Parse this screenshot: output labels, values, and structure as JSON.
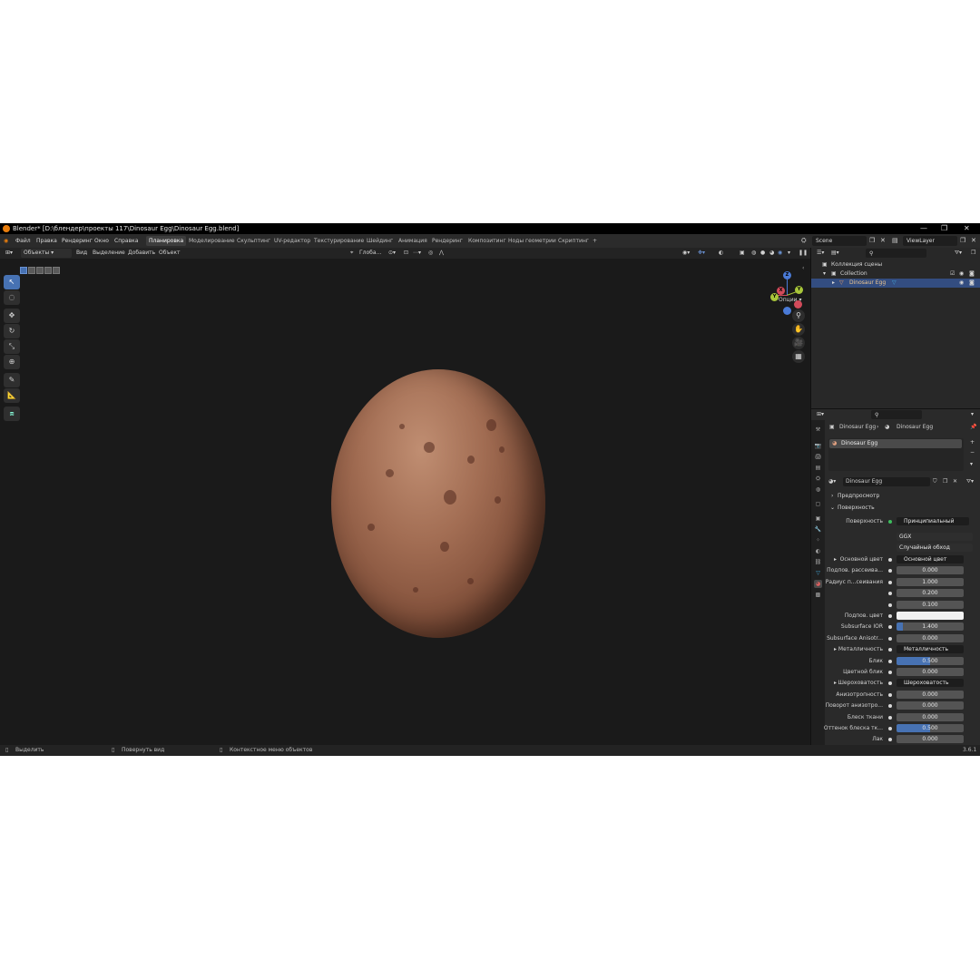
{
  "title_bar": {
    "title": "Blender* [D:\\блендер\\проекты 117\\Dinosaur Egg\\Dinosaur Egg.blend]",
    "minimize": "—",
    "maximize": "❐",
    "close": "✕"
  },
  "menu": [
    "Файл",
    "Правка",
    "Рендеринг",
    "Окно",
    "Справка"
  ],
  "workspaces": [
    {
      "label": "Планировка",
      "active": true
    },
    {
      "label": "Моделирование"
    },
    {
      "label": "Скульптинг"
    },
    {
      "label": "UV-редактор"
    },
    {
      "label": "Текстурирование"
    },
    {
      "label": "Шейдинг"
    },
    {
      "label": "Анимация"
    },
    {
      "label": "Рендеринг"
    },
    {
      "label": "Композитинг"
    },
    {
      "label": "Ноды геометрии"
    },
    {
      "label": "Скриптинг"
    }
  ],
  "add_workspace": "+",
  "scene_name": "Scene",
  "viewlayer_name": "ViewLayer",
  "viewport_header": {
    "mode": "Объекты",
    "menus": [
      "Вид",
      "Выделение",
      "Добавить",
      "Объект"
    ],
    "transform_orientation": "Глоба...",
    "options": "Опции"
  },
  "gizmo": {
    "x": "X",
    "y": "Y",
    "z": "Z"
  },
  "status_bar": {
    "select": "Выделить",
    "rotate": "Повернуть вид",
    "context": "Контекстное меню объектов",
    "version": "3.6.1"
  },
  "outliner": {
    "scene_collection": "Коллекция сцены",
    "collection": "Collection",
    "object": "Dinosaur Egg"
  },
  "properties": {
    "breadcrumb_object": "Dinosaur Egg",
    "breadcrumb_material": "Dinosaur Egg",
    "slot_name": "Dinosaur Egg",
    "material_name": "Dinosaur Egg",
    "panel_preview": "Предпросмотр",
    "panel_surface": "Поверхность",
    "surface_label": "Поверхность",
    "surface_value": "Принципиальный BSDF",
    "distribution": "GGX",
    "subsurface_method": "Случайный обход",
    "rows": [
      {
        "label": "Основной цвет",
        "value": "Основной цвет",
        "kind": "link",
        "expand": true
      },
      {
        "label": "Подпов. рассеива...",
        "value": "0.000",
        "kind": "num",
        "fill": 0
      },
      {
        "label": "Радиус п...сеивания",
        "value": "1.000",
        "kind": "num",
        "fill": 0
      },
      {
        "label": "",
        "value": "0.200",
        "kind": "num",
        "fill": 0
      },
      {
        "label": "",
        "value": "0.100",
        "kind": "num",
        "fill": 0
      },
      {
        "label": "Подпов. цвет",
        "value": "",
        "kind": "color"
      },
      {
        "label": "Subsurface IOR",
        "value": "1.400",
        "kind": "num",
        "fill": 0.1
      },
      {
        "label": "Subsurface Anisotr...",
        "value": "0.000",
        "kind": "num",
        "fill": 0
      },
      {
        "label": "Металличность",
        "value": "Металличность",
        "kind": "link",
        "expand": true
      },
      {
        "label": "Блик",
        "value": "0.500",
        "kind": "num",
        "fill": 0.5
      },
      {
        "label": "Цветной блик",
        "value": "0.000",
        "kind": "num",
        "fill": 0
      },
      {
        "label": "Шероховатость",
        "value": "Шероховатость",
        "kind": "link",
        "expand": true
      },
      {
        "label": "Анизотропность",
        "value": "0.000",
        "kind": "num",
        "fill": 0
      },
      {
        "label": "Поворот анизотро...",
        "value": "0.000",
        "kind": "num",
        "fill": 0
      },
      {
        "label": "Блеск ткани",
        "value": "0.000",
        "kind": "num",
        "fill": 0
      },
      {
        "label": "Оттенок блеска тк...",
        "value": "0.500",
        "kind": "num",
        "fill": 0.5
      },
      {
        "label": "Лак",
        "value": "0.000",
        "kind": "num",
        "fill": 0
      }
    ]
  },
  "colors": {
    "accent": "#4772b3",
    "selection": "#334d80",
    "egg": "#a26d53"
  }
}
